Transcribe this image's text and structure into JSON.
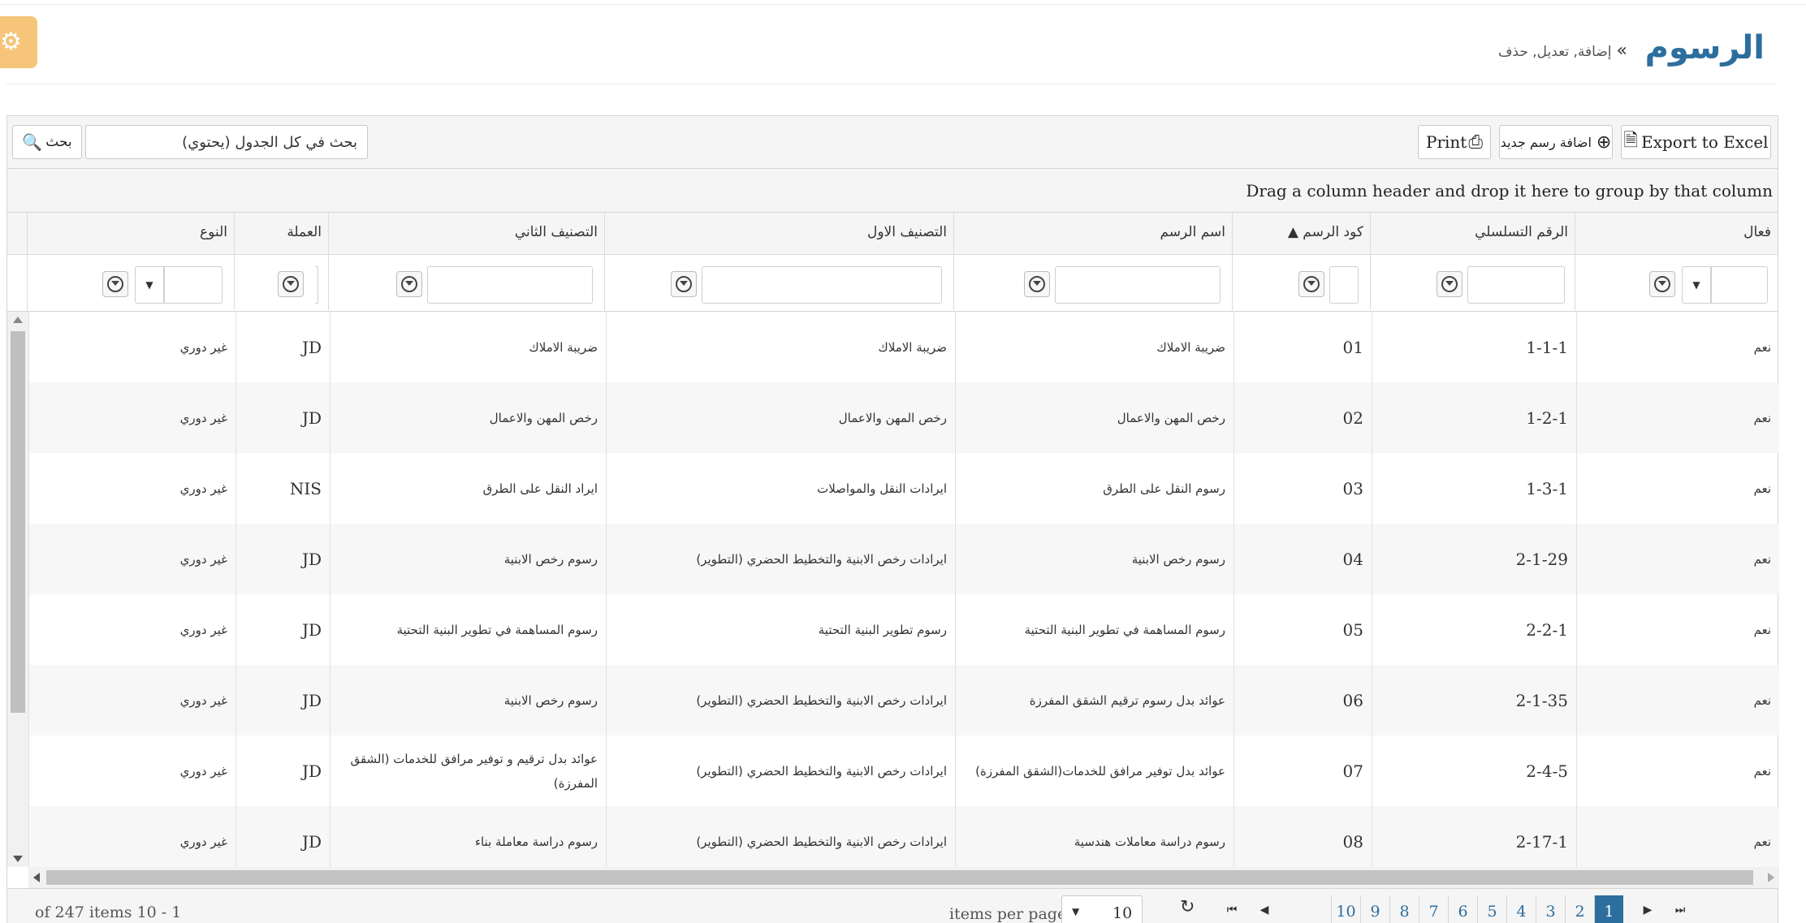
{
  "header": {
    "title": "الرسوم",
    "subtitle": "إضافة, تعديل, حذف",
    "separator": "»",
    "settings_icon": "gear-icon"
  },
  "toolbar": {
    "export_label": "Export to Excel",
    "add_label": "اضافة رسم جديد",
    "print_label": "Print",
    "search_placeholder": "بحث في كل الجدول (يحتوي)",
    "search_button_label": "بحث"
  },
  "group_bar": {
    "text": "Drag a column header and drop it here to group by that column"
  },
  "columns": [
    "فعال",
    "الرقم التسلسلي",
    "كود الرسم ▲",
    "اسم الرسم",
    "التصنيف الاول",
    "التصنيف الثاني",
    "العملة",
    "النوع"
  ],
  "rows": [
    {
      "active": "نعم",
      "serial": "1-1-1",
      "code": "01",
      "name": "ضريبة الاملاك",
      "cat1": "ضريبة الاملاك",
      "cat2": "ضريبة الاملاك",
      "currency": "JD",
      "type": "غير دوري"
    },
    {
      "active": "نعم",
      "serial": "1-2-1",
      "code": "02",
      "name": "رخص المهن والاعمال",
      "cat1": "رخص المهن والاعمال",
      "cat2": "رخص المهن والاعمال",
      "currency": "JD",
      "type": "غير دوري"
    },
    {
      "active": "نعم",
      "serial": "1-3-1",
      "code": "03",
      "name": "رسوم النقل على الطرق",
      "cat1": "ايرادات النقل والمواصلات",
      "cat2": "ايراد النقل على الطرق",
      "currency": "NIS",
      "type": "غير دوري"
    },
    {
      "active": "نعم",
      "serial": "2-1-29",
      "code": "04",
      "name": "رسوم رخص الابنية",
      "cat1": "ايرادات رخص الابنية والتخطيط الحضري (التطوير)",
      "cat2": "رسوم رخص الابنية",
      "currency": "JD",
      "type": "غير دوري"
    },
    {
      "active": "نعم",
      "serial": "2-2-1",
      "code": "05",
      "name": "رسوم المساهمة في تطوير البنية التحتية",
      "cat1": "رسوم تطوير البنية التحتية",
      "cat2": "رسوم المساهمة في تطوير البنية التحتية",
      "currency": "JD",
      "type": "غير دوري"
    },
    {
      "active": "نعم",
      "serial": "2-1-35",
      "code": "06",
      "name": "عوائد بدل رسوم ترقيم الشقق المفرزة",
      "cat1": "ايرادات رخص الابنية والتخطيط الحضري (التطوير)",
      "cat2": "رسوم رخص الابنية",
      "currency": "JD",
      "type": "غير دوري"
    },
    {
      "active": "نعم",
      "serial": "2-4-5",
      "code": "07",
      "name": "عوائد بدل توفير مرافق للخدمات(الشقق المفرزة)",
      "cat1": "ايرادات رخص الابنية والتخطيط الحضري (التطوير)",
      "cat2": "عوائد بدل ترقيم و توفير مرافق للخدمات (الشقق المفرزة)",
      "currency": "JD",
      "type": "غير دوري"
    },
    {
      "active": "نعم",
      "serial": "2-17-1",
      "code": "08",
      "name": "رسوم دراسة معاملات هندسية",
      "cat1": "ايرادات رخص الابنية والتخطيط الحضري (التطوير)",
      "cat2": "رسوم دراسة معاملة بناء",
      "currency": "JD",
      "type": "غير دوري"
    }
  ],
  "pager": {
    "info": "of 247 items 10 - 1",
    "items_per_page_label": "items per page",
    "items_per_page_value": "10",
    "pages": [
      "10",
      "9",
      "8",
      "7",
      "6",
      "5",
      "4",
      "3",
      "2",
      "1"
    ],
    "active_page": "1"
  },
  "colors": {
    "accent": "#2c6e9e",
    "settings_tile": "#f6c579"
  }
}
